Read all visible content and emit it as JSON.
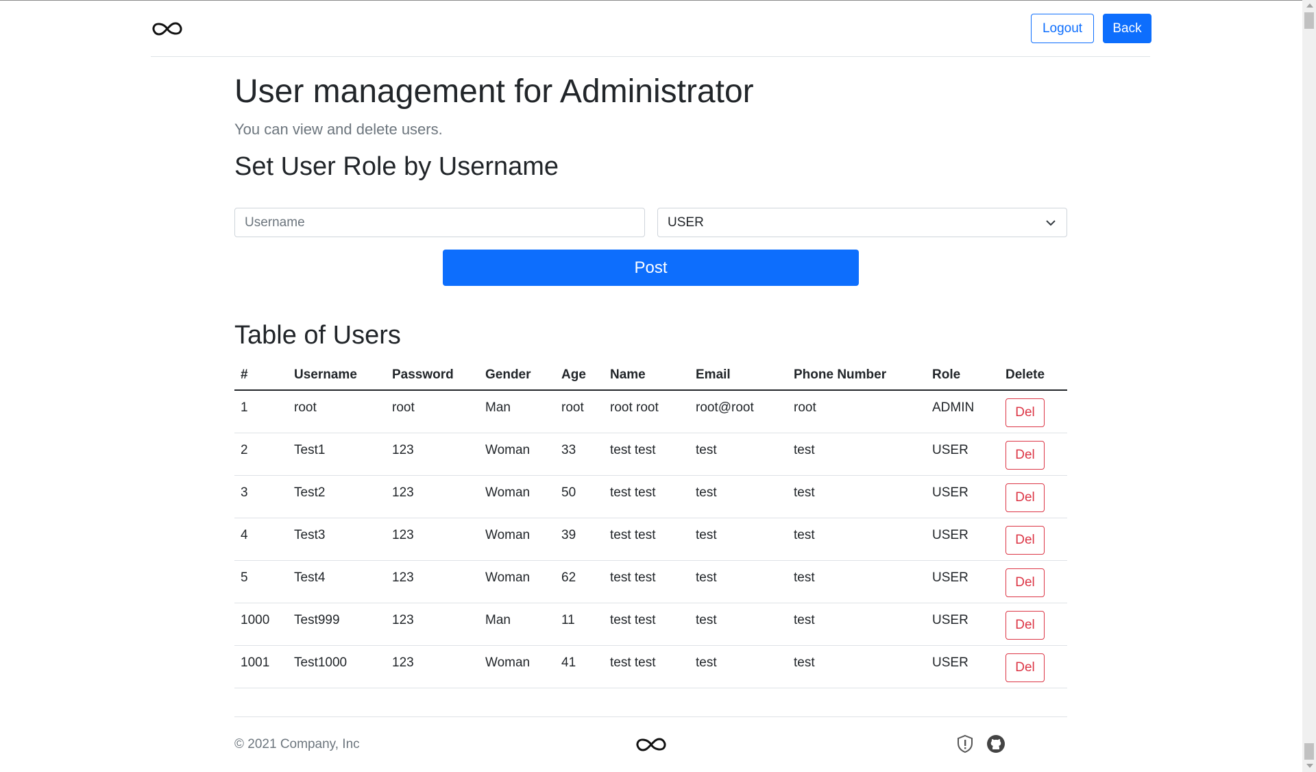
{
  "header": {
    "logo_icon": "infinity-icon",
    "logout_label": "Logout",
    "back_label": "Back"
  },
  "page": {
    "title": "User management for Administrator",
    "lead": "You can view and delete users.",
    "role_heading": "Set User Role by Username",
    "table_heading": "Table of Users"
  },
  "form": {
    "username_placeholder": "Username",
    "username_value": "",
    "role_selected": "USER",
    "post_label": "Post"
  },
  "table": {
    "columns": [
      "#",
      "Username",
      "Password",
      "Gender",
      "Age",
      "Name",
      "Email",
      "Phone Number",
      "Role",
      "Delete"
    ],
    "rows": [
      {
        "id": "1",
        "username": "root",
        "password": "root",
        "gender": "Man",
        "age": "root",
        "name": "root root",
        "email": "root@root",
        "phone": "root",
        "role": "ADMIN",
        "delete": "Del"
      },
      {
        "id": "2",
        "username": "Test1",
        "password": "123",
        "gender": "Woman",
        "age": "33",
        "name": "test test",
        "email": "test",
        "phone": "test",
        "role": "USER",
        "delete": "Del"
      },
      {
        "id": "3",
        "username": "Test2",
        "password": "123",
        "gender": "Woman",
        "age": "50",
        "name": "test test",
        "email": "test",
        "phone": "test",
        "role": "USER",
        "delete": "Del"
      },
      {
        "id": "4",
        "username": "Test3",
        "password": "123",
        "gender": "Woman",
        "age": "39",
        "name": "test test",
        "email": "test",
        "phone": "test",
        "role": "USER",
        "delete": "Del"
      },
      {
        "id": "5",
        "username": "Test4",
        "password": "123",
        "gender": "Woman",
        "age": "62",
        "name": "test test",
        "email": "test",
        "phone": "test",
        "role": "USER",
        "delete": "Del"
      },
      {
        "id": "1000",
        "username": "Test999",
        "password": "123",
        "gender": "Man",
        "age": "11",
        "name": "test test",
        "email": "test",
        "phone": "test",
        "role": "USER",
        "delete": "Del"
      },
      {
        "id": "1001",
        "username": "Test1000",
        "password": "123",
        "gender": "Woman",
        "age": "41",
        "name": "test test",
        "email": "test",
        "phone": "test",
        "role": "USER",
        "delete": "Del"
      }
    ]
  },
  "footer": {
    "copyright": "© 2021 Company, Inc",
    "logo_icon": "infinity-icon",
    "icons": [
      "shield-icon",
      "github-icon"
    ]
  },
  "colors": {
    "primary": "#0d6efd",
    "danger": "#dc3545",
    "muted": "#6c757d",
    "text": "#212529",
    "border": "#dee2e6"
  }
}
